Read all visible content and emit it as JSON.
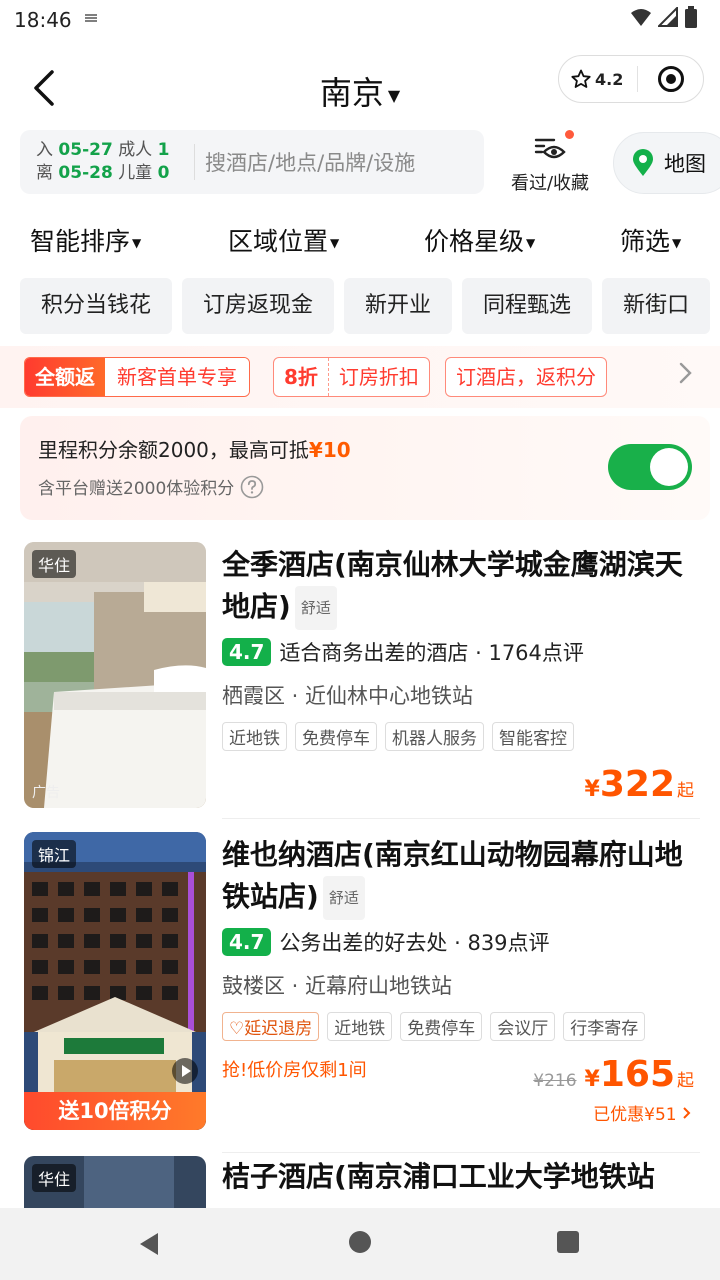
{
  "status_bar": {
    "time": "18:46",
    "sub_icon": "notification-icon"
  },
  "header": {
    "city": "南京",
    "rating": "4.2"
  },
  "search": {
    "checkin_label": "入",
    "checkin_date": "05-27",
    "checkout_label": "离",
    "checkout_date": "05-28",
    "adults_label": "成人",
    "adults_count": "1",
    "children_label": "儿童",
    "children_count": "0",
    "placeholder": "搜酒店/地点/品牌/设施",
    "favorites_label": "看过/收藏",
    "map_label": "地图"
  },
  "sort": [
    "智能排序",
    "区域位置",
    "价格星级",
    "筛选"
  ],
  "chips": [
    "积分当钱花",
    "订房返现金",
    "新开业",
    "同程甄选",
    "新街口"
  ],
  "promo": {
    "p1_tag": "全额返",
    "p1_text": "新客首单专享",
    "p2_tag": "8折",
    "p2_text": "订房折扣",
    "p3_text": "订酒店，返积分"
  },
  "points": {
    "title": "里程积分余额2000，最高可抵",
    "amount": "¥10",
    "subtitle": "含平台赠送2000体验积分",
    "enabled": true
  },
  "hotels": [
    {
      "brand": "华住",
      "ad": "广告",
      "name": "全季酒店(南京仙林大学城金鹰湖滨天地店)",
      "level": "舒适",
      "score": "4.7",
      "desc": "适合商务出差的酒店 · 1764点评",
      "addr": "栖霞区 · 近仙林中心地铁站",
      "tags": [
        "近地铁",
        "免费停车",
        "机器人服务",
        "智能客控"
      ],
      "currency": "¥",
      "price": "322",
      "suffix": "起"
    },
    {
      "brand": "锦江",
      "name": "维也纳酒店(南京红山动物园幕府山地铁站店)",
      "level": "舒适",
      "score": "4.7",
      "desc": "公务出差的好去处 · 839点评",
      "addr": "鼓楼区 · 近幕府山地铁站",
      "tags": [
        "延迟退房",
        "近地铁",
        "免费停车",
        "会议厅",
        "行李寄存"
      ],
      "urgent": "抢!低价房仅剩1间",
      "old_price": "¥216",
      "currency": "¥",
      "price": "165",
      "suffix": "起",
      "saved": "已优惠¥51",
      "bonus": "送10倍积分"
    },
    {
      "brand": "华住",
      "name": "桔子酒店(南京浦口工业大学地铁站"
    }
  ]
}
